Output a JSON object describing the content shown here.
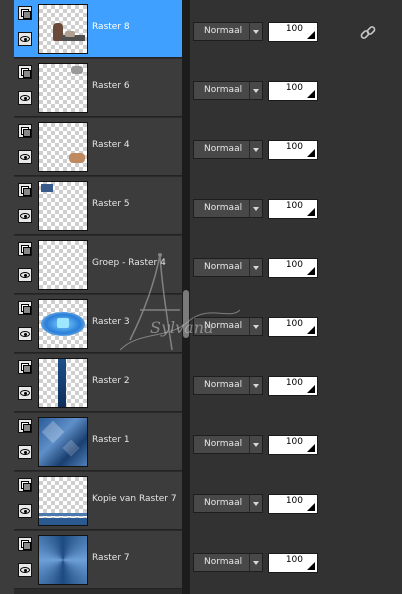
{
  "layers": [
    {
      "name": "Raster 8",
      "blend_mode": "Normaal",
      "opacity": "100",
      "selected": true,
      "linked": true
    },
    {
      "name": "Raster 6",
      "blend_mode": "Normaal",
      "opacity": "100"
    },
    {
      "name": "Raster 4",
      "blend_mode": "Normaal",
      "opacity": "100"
    },
    {
      "name": "Raster 5",
      "blend_mode": "Normaal",
      "opacity": "100"
    },
    {
      "name": "Groep - Raster 4",
      "blend_mode": "Normaal",
      "opacity": "100"
    },
    {
      "name": "Raster 3",
      "blend_mode": "Normaal",
      "opacity": "100"
    },
    {
      "name": "Raster 2",
      "blend_mode": "Normaal",
      "opacity": "100"
    },
    {
      "name": "Raster 1",
      "blend_mode": "Normaal",
      "opacity": "100"
    },
    {
      "name": "Kopie van Raster 7",
      "blend_mode": "Normaal",
      "opacity": "100"
    },
    {
      "name": "Raster 7",
      "blend_mode": "Normaal",
      "opacity": "100"
    }
  ],
  "watermark": {
    "text": "Sylvana"
  },
  "colors": {
    "selection": "#40a0ff",
    "row_bg": "#3c3c3c",
    "panel_bg": "#323232"
  }
}
